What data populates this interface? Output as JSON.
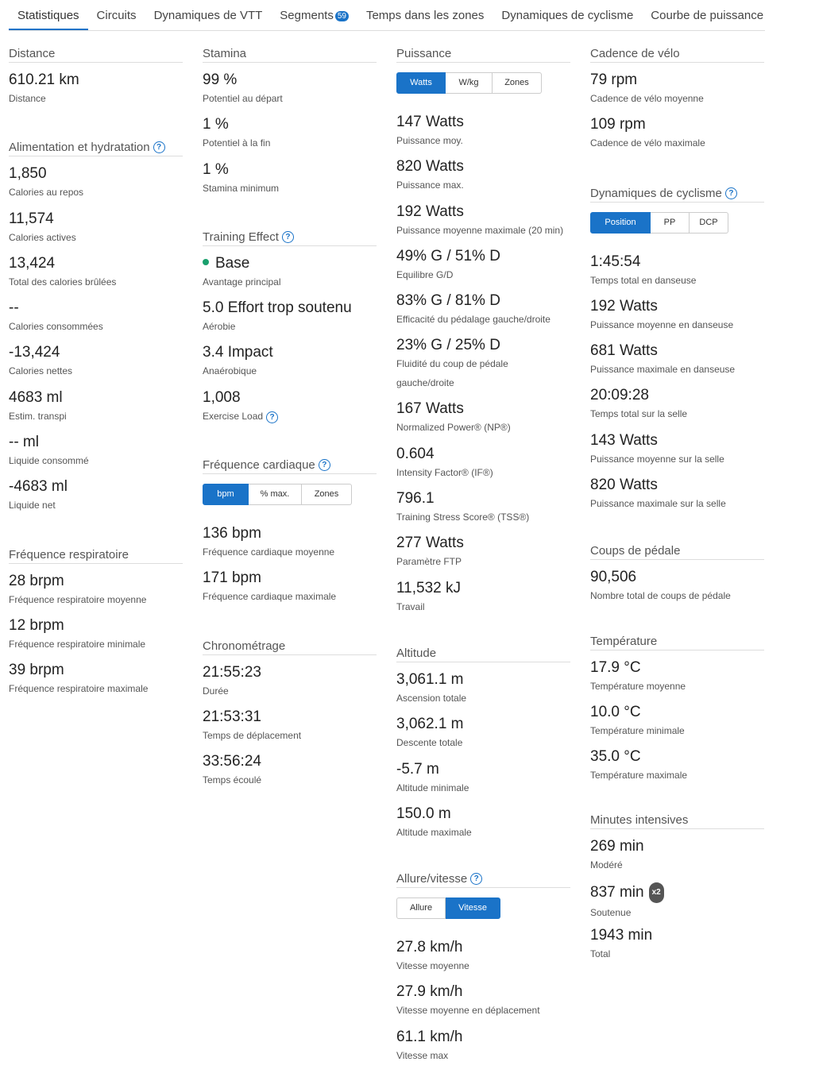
{
  "tabs": [
    {
      "label": "Statistiques",
      "active": true
    },
    {
      "label": "Circuits"
    },
    {
      "label": "Dynamiques de VTT"
    },
    {
      "label": "Segments",
      "badge": "59"
    },
    {
      "label": "Temps dans les zones"
    },
    {
      "label": "Dynamiques de cyclisme"
    },
    {
      "label": "Courbe de puissance"
    }
  ],
  "distance": {
    "title": "Distance",
    "stats": [
      {
        "value": "610.21 km",
        "label": "Distance"
      }
    ]
  },
  "nutrition": {
    "title": "Alimentation et hydratation",
    "stats": [
      {
        "value": "1,850",
        "label": "Calories au repos"
      },
      {
        "value": "11,574",
        "label": "Calories actives"
      },
      {
        "value": "13,424",
        "label": "Total des calories brûlées"
      },
      {
        "value": "--",
        "label": "Calories consommées"
      },
      {
        "value": "-13,424",
        "label": "Calories nettes"
      },
      {
        "value": "4683 ml",
        "label": "Estim. transpi"
      },
      {
        "value": "-- ml",
        "label": "Liquide consommé"
      },
      {
        "value": "-4683 ml",
        "label": "Liquide net"
      }
    ]
  },
  "respiration": {
    "title": "Fréquence respiratoire",
    "stats": [
      {
        "value": "28 brpm",
        "label": "Fréquence respiratoire moyenne"
      },
      {
        "value": "12 brpm",
        "label": "Fréquence respiratoire minimale"
      },
      {
        "value": "39 brpm",
        "label": "Fréquence respiratoire maximale"
      }
    ]
  },
  "stamina": {
    "title": "Stamina",
    "stats": [
      {
        "value": "99 %",
        "label": "Potentiel au départ"
      },
      {
        "value": "1 %",
        "label": "Potentiel à la fin"
      },
      {
        "value": "1 %",
        "label": "Stamina minimum"
      }
    ]
  },
  "training": {
    "title": "Training Effect",
    "stats": [
      {
        "value": "Base",
        "label": "Avantage principal"
      },
      {
        "value": "5.0 Effort trop soutenu",
        "label": "Aérobie"
      },
      {
        "value": "3.4 Impact",
        "label": "Anaérobique"
      },
      {
        "value": "1,008",
        "label": "Exercise Load"
      }
    ]
  },
  "heart": {
    "title": "Fréquence cardiaque",
    "buttons": [
      "bpm",
      "% max.",
      "Zones"
    ],
    "stats": [
      {
        "value": "136 bpm",
        "label": "Fréquence cardiaque moyenne"
      },
      {
        "value": "171 bpm",
        "label": "Fréquence cardiaque maximale"
      }
    ]
  },
  "timing": {
    "title": "Chronométrage",
    "stats": [
      {
        "value": "21:55:23",
        "label": "Durée"
      },
      {
        "value": "21:53:31",
        "label": "Temps de déplacement"
      },
      {
        "value": "33:56:24",
        "label": "Temps écoulé"
      }
    ]
  },
  "power": {
    "title": "Puissance",
    "buttons": [
      "Watts",
      "W/kg",
      "Zones"
    ],
    "stats": [
      {
        "value": "147 Watts",
        "label": "Puissance moy."
      },
      {
        "value": "820 Watts",
        "label": "Puissance max."
      },
      {
        "value": "192 Watts",
        "label": "Puissance moyenne maximale (20 min)"
      },
      {
        "value": "49% G / 51% D",
        "label": "Equilibre G/D"
      },
      {
        "value": "83% G / 81% D",
        "label": "Efficacité du pédalage gauche/droite"
      },
      {
        "value": "23% G / 25% D",
        "label": "Fluidité du coup de pédale gauche/droite"
      },
      {
        "value": "167 Watts",
        "label": "Normalized Power® (NP®)"
      },
      {
        "value": "0.604",
        "label": "Intensity Factor® (IF®)"
      },
      {
        "value": "796.1",
        "label": "Training Stress Score® (TSS®)"
      },
      {
        "value": "277 Watts",
        "label": "Paramètre FTP"
      },
      {
        "value": "11,532 kJ",
        "label": "Travail"
      }
    ]
  },
  "altitude": {
    "title": "Altitude",
    "stats": [
      {
        "value": "3,061.1 m",
        "label": "Ascension totale"
      },
      {
        "value": "3,062.1 m",
        "label": "Descente totale"
      },
      {
        "value": "-5.7 m",
        "label": "Altitude minimale"
      },
      {
        "value": "150.0 m",
        "label": "Altitude maximale"
      }
    ]
  },
  "speed": {
    "title": "Allure/vitesse",
    "buttons": [
      "Allure",
      "Vitesse"
    ],
    "stats": [
      {
        "value": "27.8 km/h",
        "label": "Vitesse moyenne"
      },
      {
        "value": "27.9 km/h",
        "label": "Vitesse moyenne en déplacement"
      },
      {
        "value": "61.1 km/h",
        "label": "Vitesse max"
      }
    ]
  },
  "cadence": {
    "title": "Cadence de vélo",
    "stats": [
      {
        "value": "79 rpm",
        "label": "Cadence de vélo moyenne"
      },
      {
        "value": "109 rpm",
        "label": "Cadence de vélo maximale"
      }
    ]
  },
  "dynamics": {
    "title": "Dynamiques de cyclisme",
    "buttons": [
      "Position",
      "PP",
      "DCP"
    ],
    "stats": [
      {
        "value": "1:45:54",
        "label": "Temps total en danseuse"
      },
      {
        "value": "192 Watts",
        "label": "Puissance moyenne en danseuse"
      },
      {
        "value": "681 Watts",
        "label": "Puissance maximale en danseuse"
      },
      {
        "value": "20:09:28",
        "label": "Temps total sur la selle"
      },
      {
        "value": "143 Watts",
        "label": "Puissance moyenne sur la selle"
      },
      {
        "value": "820 Watts",
        "label": "Puissance maximale sur la selle"
      }
    ]
  },
  "strokes": {
    "title": "Coups de pédale",
    "stats": [
      {
        "value": "90,506",
        "label": "Nombre total de coups de pédale"
      }
    ]
  },
  "temperature": {
    "title": "Température",
    "stats": [
      {
        "value": "17.9 °C",
        "label": "Température moyenne"
      },
      {
        "value": "10.0 °C",
        "label": "Température minimale"
      },
      {
        "value": "35.0 °C",
        "label": "Température maximale"
      }
    ]
  },
  "intensity": {
    "title": "Minutes intensives",
    "multiplier": "x2",
    "stats": [
      {
        "value": "269 min",
        "label": "Modéré"
      },
      {
        "value": "837 min",
        "label": "Soutenue"
      },
      {
        "value": "1943 min",
        "label": "Total"
      }
    ]
  },
  "icons": {
    "help": "help-circle-icon",
    "dot": "status-dot-icon"
  },
  "colors": {
    "accent": "#1a73c8",
    "base_dot": "#1aa06d"
  }
}
